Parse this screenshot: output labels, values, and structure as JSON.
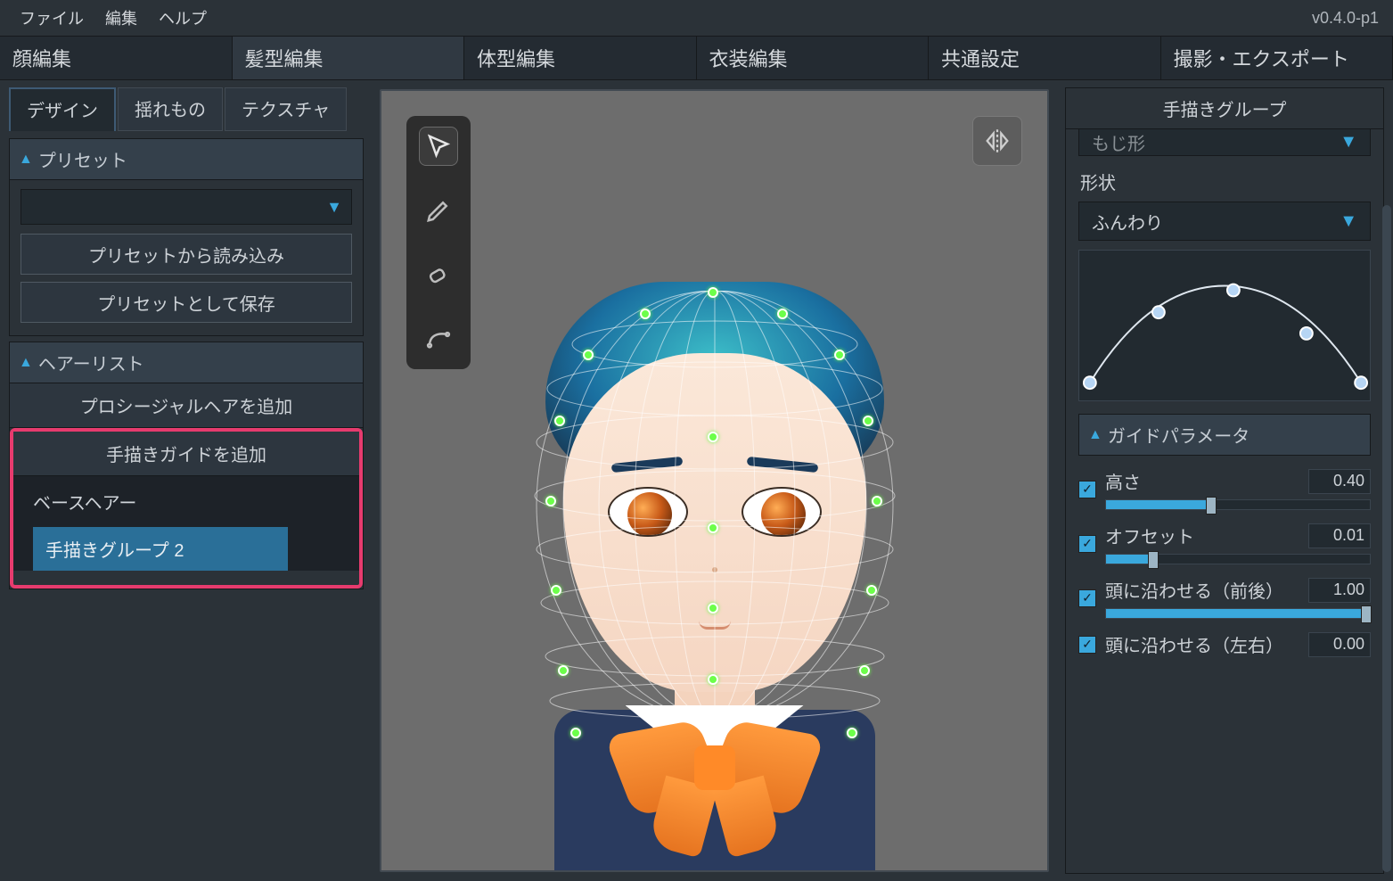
{
  "menu": {
    "file": "ファイル",
    "edit": "編集",
    "help": "ヘルプ"
  },
  "version": "v0.4.0-p1",
  "toptabs": {
    "face": "顔編集",
    "hair": "髪型編集",
    "body": "体型編集",
    "outfit": "衣装編集",
    "common": "共通設定",
    "export": "撮影・エクスポート"
  },
  "subtabs": {
    "design": "デザイン",
    "sway": "揺れもの",
    "texture": "テクスチャ"
  },
  "preset": {
    "header": "プリセット",
    "load": "プリセットから読み込み",
    "save": "プリセットとして保存"
  },
  "hairlist": {
    "header": "ヘアーリスト",
    "add_procedural": "プロシージャルヘアを追加",
    "add_handdrawn": "手描きガイドを追加",
    "base": "ベースヘアー",
    "group2": "手描きグループ 2"
  },
  "right": {
    "title": "手描きグループ",
    "partial_dd": "もじ形",
    "shape_label": "形状",
    "shape_value": "ふんわり",
    "guide_header": "ガイドパラメータ",
    "params": [
      {
        "name": "高さ",
        "value": "0.40",
        "fill": 40
      },
      {
        "name": "オフセット",
        "value": "0.01",
        "fill": 18
      },
      {
        "name": "頭に沿わせる（前後）",
        "value": "1.00",
        "fill": 100
      },
      {
        "name": "頭に沿わせる（左右）",
        "value": "0.00",
        "fill": 0
      }
    ]
  }
}
